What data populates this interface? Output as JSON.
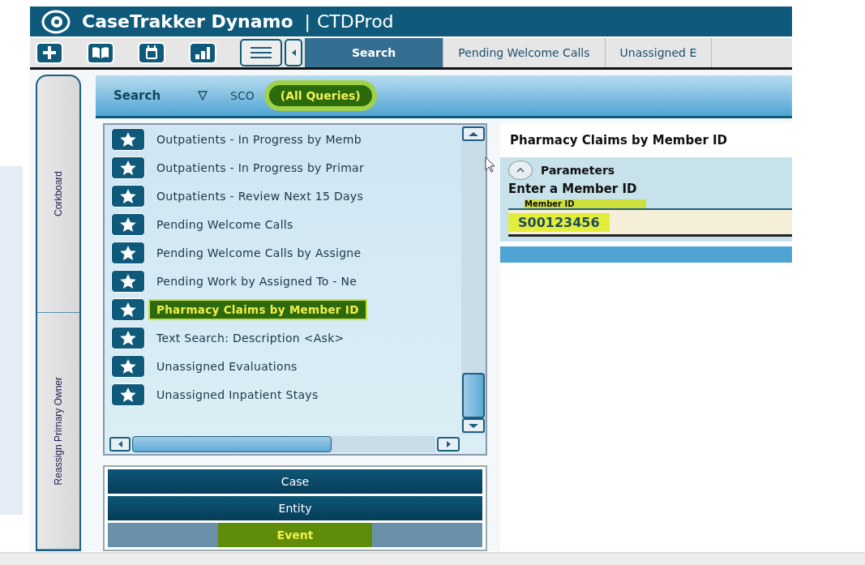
{
  "window": {
    "title": "CaseTrakker Dynamo",
    "separator": "|",
    "environment": "CTDProd"
  },
  "toolbar": {
    "icons": [
      {
        "kind": "plus"
      },
      {
        "kind": "book"
      },
      {
        "kind": "calendar"
      },
      {
        "kind": "chart"
      }
    ],
    "tabs": [
      {
        "label": "Search",
        "selected": true
      },
      {
        "label": "Pending Welcome Calls",
        "selected": false
      },
      {
        "label": "Unassigned E",
        "selected": false
      }
    ]
  },
  "side_tabs": [
    {
      "label": "Corkboard"
    },
    {
      "label": "Reassign Primary Owner"
    }
  ],
  "search_header": {
    "title": "Search",
    "filters": [
      {
        "label": "SCO",
        "selected": false
      },
      {
        "label": "(All Queries)",
        "selected": true
      }
    ]
  },
  "queries": [
    {
      "label": "Outpatients - In Progress by Memb",
      "selected": false
    },
    {
      "label": "Outpatients - In Progress by Primar",
      "selected": false
    },
    {
      "label": "Outpatients - Review Next 15 Days",
      "selected": false
    },
    {
      "label": "Pending Welcome Calls",
      "selected": false
    },
    {
      "label": "Pending Welcome Calls by Assigne",
      "selected": false
    },
    {
      "label": "Pending Work by Assigned To - Ne",
      "selected": false
    },
    {
      "label": "Pharmacy Claims by Member ID",
      "selected": true
    },
    {
      "label": "Text Search: Description <Ask>",
      "selected": false
    },
    {
      "label": "Unassigned Evaluations",
      "selected": false
    },
    {
      "label": "Unassigned Inpatient Stays",
      "selected": false
    }
  ],
  "categories": [
    {
      "label": "Case",
      "selected": false
    },
    {
      "label": "Entity",
      "selected": false
    },
    {
      "label": "Event",
      "selected": true
    }
  ],
  "query_panel": {
    "title": "Pharmacy Claims by Member ID",
    "section": "Parameters",
    "expanded": true,
    "prompt": "Enter a Member ID",
    "field": {
      "label": "Member ID",
      "value": "S00123456",
      "value_selected": true
    }
  }
}
